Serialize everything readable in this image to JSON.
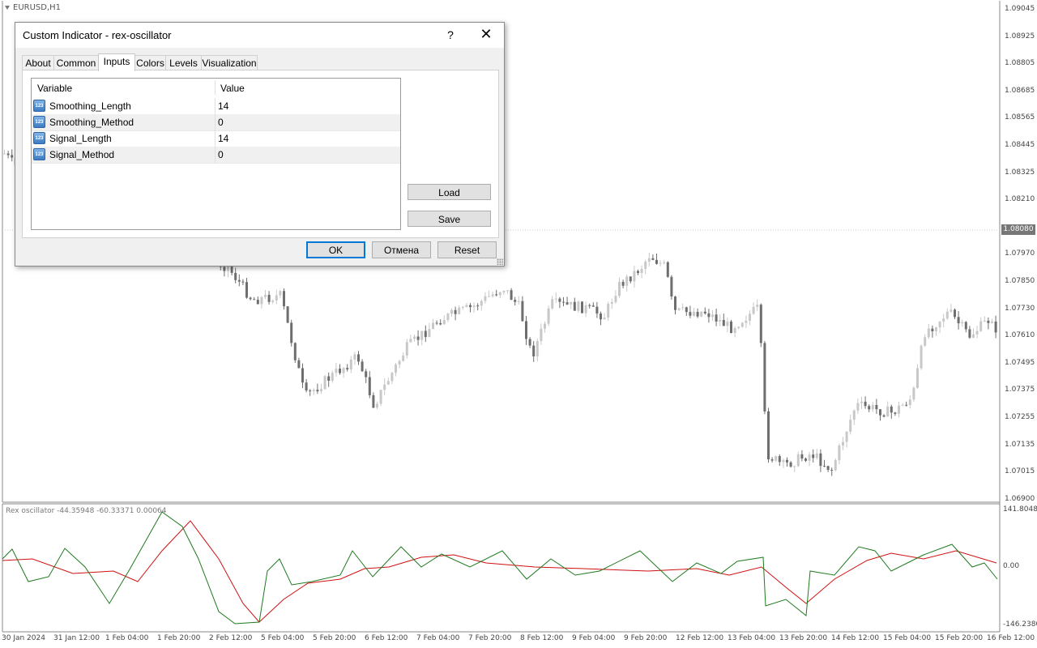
{
  "chart": {
    "symbol": "EURUSD,H1",
    "indicator_label": "Rex oscillator -44.35948 -60.33371 0.00064",
    "current_price": "1.08080",
    "price_axis": [
      "1.09045",
      "1.08925",
      "1.08805",
      "1.08685",
      "1.08565",
      "1.08445",
      "1.08325",
      "1.08210",
      "1.07970",
      "1.07850",
      "1.07730",
      "1.07610",
      "1.07495",
      "1.07375",
      "1.07255",
      "1.07135",
      "1.07015",
      "1.06900"
    ],
    "osc_axis": [
      "141.8048",
      "0.00",
      "-146.2380"
    ],
    "time_axis": [
      "30 Jan 2024",
      "31 Jan 12:00",
      "1 Feb 04:00",
      "1 Feb 20:00",
      "2 Feb 12:00",
      "5 Feb 04:00",
      "5 Feb 20:00",
      "6 Feb 12:00",
      "7 Feb 04:00",
      "7 Feb 20:00",
      "8 Feb 12:00",
      "9 Feb 04:00",
      "9 Feb 20:00",
      "12 Feb 12:00",
      "13 Feb 04:00",
      "13 Feb 20:00",
      "14 Feb 12:00",
      "15 Feb 04:00",
      "15 Feb 20:00",
      "16 Feb 12:00"
    ],
    "colors": {
      "bull": "#c8c8c8",
      "bear": "#6e6e6e",
      "osc_main": "#1e7a1e",
      "osc_signal": "#d01010",
      "grid": "#c0c0c0"
    }
  },
  "dialog": {
    "title": "Custom Indicator - rex-oscillator",
    "help": "?",
    "tabs": [
      "About",
      "Common",
      "Inputs",
      "Colors",
      "Levels",
      "Visualization"
    ],
    "active_tab": "Inputs",
    "grid_headers": {
      "variable": "Variable",
      "value": "Value"
    },
    "param_icon_text": "123",
    "params": [
      {
        "name": "Smoothing_Length",
        "value": "14"
      },
      {
        "name": "Smoothing_Method",
        "value": "0"
      },
      {
        "name": "Signal_Length",
        "value": "14"
      },
      {
        "name": "Signal_Method",
        "value": "0"
      }
    ],
    "buttons": {
      "load": "Load",
      "save": "Save",
      "ok": "OK",
      "cancel": "Отмена",
      "reset": "Reset"
    }
  }
}
